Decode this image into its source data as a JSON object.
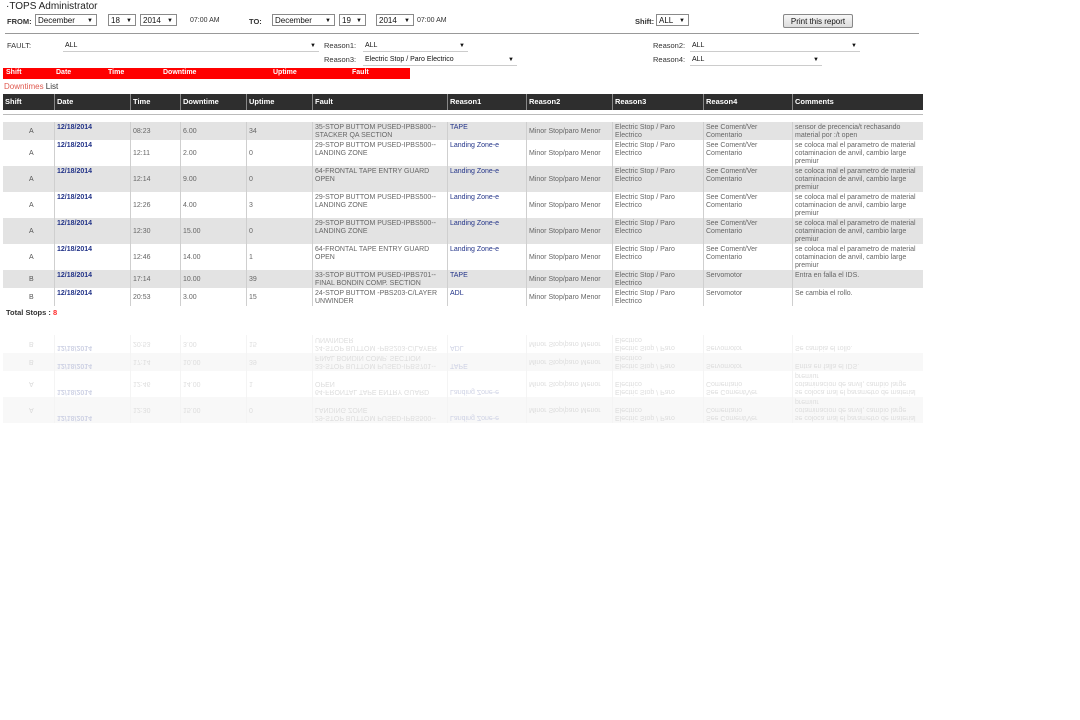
{
  "app": {
    "title": "·TOPS Administrator"
  },
  "filters": {
    "from_label": "FROM:",
    "from_month": "December",
    "from_day": "18",
    "from_year": "2014",
    "from_time": "07:00 AM",
    "to_label": "TO:",
    "to_month": "December",
    "to_day": "19",
    "to_year": "2014",
    "to_time": "07:00 AM",
    "shift_label": "Shift:",
    "shift_value": "ALL",
    "print_button": "Print this report",
    "fault_label": "FAULT:",
    "fault_value": "ALL",
    "reason1_label": "Reason1:",
    "reason1_value": "ALL",
    "reason2_label": "Reason2:",
    "reason2_value": "ALL",
    "reason3_label": "Reason3:",
    "reason3_value": "Electric Stop / Paro Electrico",
    "reason4_label": "Reason4:",
    "reason4_value": "ALL"
  },
  "summary_bar": {
    "shift": "Shift",
    "date": "Date",
    "time": "Time",
    "downtime": "Downtime",
    "uptime": "Uptime",
    "fault": "Fault"
  },
  "list_title": {
    "highlight": "Downtimes",
    "rest": " List"
  },
  "table": {
    "headers": [
      "Shift",
      "Date",
      "Time",
      "Downtime",
      "Uptime",
      "Fault",
      "Reason1",
      "Reason2",
      "Reason3",
      "Reason4",
      "Comments"
    ],
    "rows": [
      [
        "A",
        "12/18/2014",
        "08:23",
        "6.00",
        "34",
        "35-STOP BUTTOM PUSED-IPBS800--STACKER QA SECTION",
        "TAPE",
        "Minor Stop/paro Menor",
        "Electric Stop / Paro Electrico",
        "See Coment/Ver Comentario",
        "sensor de precencia/t rechasando material por :/t open"
      ],
      [
        "A",
        "12/18/2014",
        "12:11",
        "2.00",
        "0",
        "29-STOP BUTTOM PUSED-IPBS500--LANDING ZONE",
        "Landing Zone-e",
        "Minor Stop/paro Menor",
        "Electric Stop / Paro Electrico",
        "See Coment/Ver Comentario",
        "se coloca mal el parametro de material cotaminacion de anvil, cambio large premiur"
      ],
      [
        "A",
        "12/18/2014",
        "12:14",
        "9.00",
        "0",
        "64-FRONTAL TAPE ENTRY GUARD OPEN",
        "Landing Zone-e",
        "Minor Stop/paro Menor",
        "Electric Stop / Paro Electrico",
        "See Coment/Ver Comentario",
        "se coloca mal el parametro de material cotaminacion de anvil, cambio large premiur"
      ],
      [
        "A",
        "12/18/2014",
        "12:26",
        "4.00",
        "3",
        "29-STOP BUTTOM PUSED-IPBS500--LANDING ZONE",
        "Landing Zone-e",
        "Minor Stop/paro Menor",
        "Electric Stop / Paro Electrico",
        "See Coment/Ver Comentario",
        "se coloca mal el parametro de material cotaminacion de anvil, cambio large premiur"
      ],
      [
        "A",
        "12/18/2014",
        "12:30",
        "15.00",
        "0",
        "29-STOP BUTTOM PUSED-IPBS500--LANDING ZONE",
        "Landing Zone-e",
        "Minor Stop/paro Menor",
        "Electric Stop / Paro Electrico",
        "See Coment/Ver Comentario",
        "se coloca mal el parametro de material cotaminacion de anvil, cambio large premiur"
      ],
      [
        "A",
        "12/18/2014",
        "12:46",
        "14.00",
        "1",
        "64-FRONTAL TAPE ENTRY GUARD OPEN",
        "Landing Zone-e",
        "Minor Stop/paro Menor",
        "Electric Stop / Paro Electrico",
        "See Coment/Ver Comentario",
        "se coloca mal el parametro de material cotaminacion de anvil, cambio large premiur"
      ],
      [
        "B",
        "12/18/2014",
        "17:14",
        "10.00",
        "39",
        "33-STOP BUTTOM PUSED-IPBS701--FINAL BONDIN COMP. SECTION",
        "TAPE",
        "Minor Stop/paro Menor",
        "Electric Stop / Paro Electrico",
        "Servomotor",
        "Entra en fallа el IDS."
      ],
      [
        "B",
        "12/18/2014",
        "20:53",
        "3.00",
        "15",
        "24-STOP BUTTOM -PBS203-C/LAYER UNWINDER",
        "ADL",
        "Minor Stop/paro Menor",
        "Electric Stop / Paro Electrico",
        "Servomotor",
        "Se cambia el rollo."
      ]
    ]
  },
  "totals": {
    "label": "Total Stops : ",
    "count": "8"
  }
}
